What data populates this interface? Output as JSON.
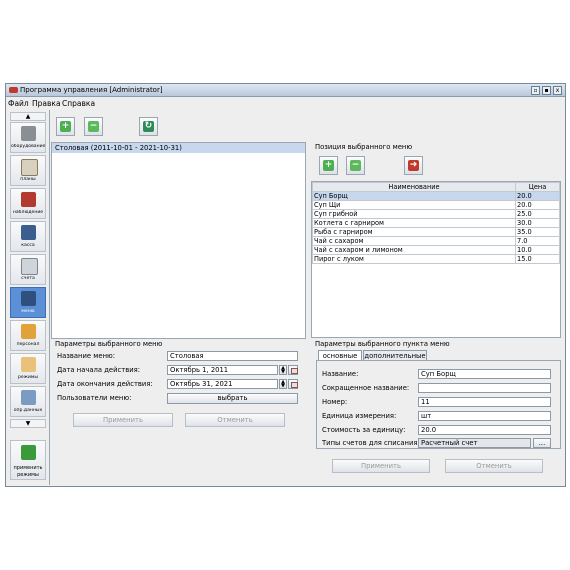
{
  "window": {
    "title": "Программа управления [Administrator]",
    "buttons": [
      "▫",
      "▪",
      "x"
    ]
  },
  "menubar": [
    "Файл",
    "Правка",
    "Справка"
  ],
  "nav": {
    "up": "▲",
    "items": [
      {
        "label": "оборудование",
        "icon": "equipment-icon"
      },
      {
        "label": "планы",
        "icon": "floor-plan-icon"
      },
      {
        "label": "наблюдение",
        "icon": "monitoring-icon"
      },
      {
        "label": "касса",
        "icon": "cash-register-icon"
      },
      {
        "label": "счета",
        "icon": "bills-icon"
      },
      {
        "label": "меню",
        "icon": "menu-icon"
      },
      {
        "label": "персонал",
        "icon": "staff-icon"
      },
      {
        "label": "режимы",
        "icon": "modes-icon"
      },
      {
        "label": "опр.данных",
        "icon": "data-icon"
      }
    ],
    "down": "▼",
    "apply_label_1": "применить",
    "apply_label_2": "режимы"
  },
  "menus": {
    "selected": "Столовая (2011-10-01 - 2021-10-31)"
  },
  "menu_params": {
    "title": "Параметры выбранного меню",
    "name_label": "Название меню:",
    "name_value": "Столовая",
    "start_label": "Дата начала действия:",
    "start_value": "Октябрь 1, 2011",
    "end_label": "Дата окончания действия:",
    "end_value": "Октябрь 31, 2021",
    "users_label": "Пользователи меню:",
    "choose_label": "выбрать",
    "apply_label": "Применить",
    "cancel_label": "Отменить"
  },
  "positions": {
    "title": "Позиция выбранного меню",
    "col_name": "Наименование",
    "col_price": "Цена",
    "rows": [
      {
        "name": "Суп Борщ",
        "price": "20.0"
      },
      {
        "name": "Суп Щи",
        "price": "20.0"
      },
      {
        "name": "Суп грибной",
        "price": "25.0"
      },
      {
        "name": "Котлета с гарниром",
        "price": "30.0"
      },
      {
        "name": "Рыба с гарниром",
        "price": "35.0"
      },
      {
        "name": "Чай с сахаром",
        "price": "7.0"
      },
      {
        "name": "Чай с сахаром и лимоном",
        "price": "10.0"
      },
      {
        "name": "Пирог с луком",
        "price": "15.0"
      }
    ]
  },
  "item_params": {
    "title": "Параметры выбранного пункта меню",
    "tab_main": "основные",
    "tab_extra": "дополнительные",
    "name_label": "Название:",
    "name_value": "Суп Борщ",
    "short_label": "Сокращенное название:",
    "short_value": "",
    "number_label": "Номер:",
    "number_value": "11",
    "unit_label": "Единица измерения:",
    "unit_value": "шт",
    "cost_label": "Стоимость за единицу:",
    "cost_value": "20.0",
    "types_label": "Типы счетов для списания:",
    "types_value": "Расчетный счет",
    "types_button": "...",
    "apply_label": "Применить",
    "cancel_label": "Отменить"
  },
  "colors": {
    "selection": "#5b8fd6",
    "header_blue": "#b8c8da",
    "row_selected": "#c6d7ee"
  }
}
